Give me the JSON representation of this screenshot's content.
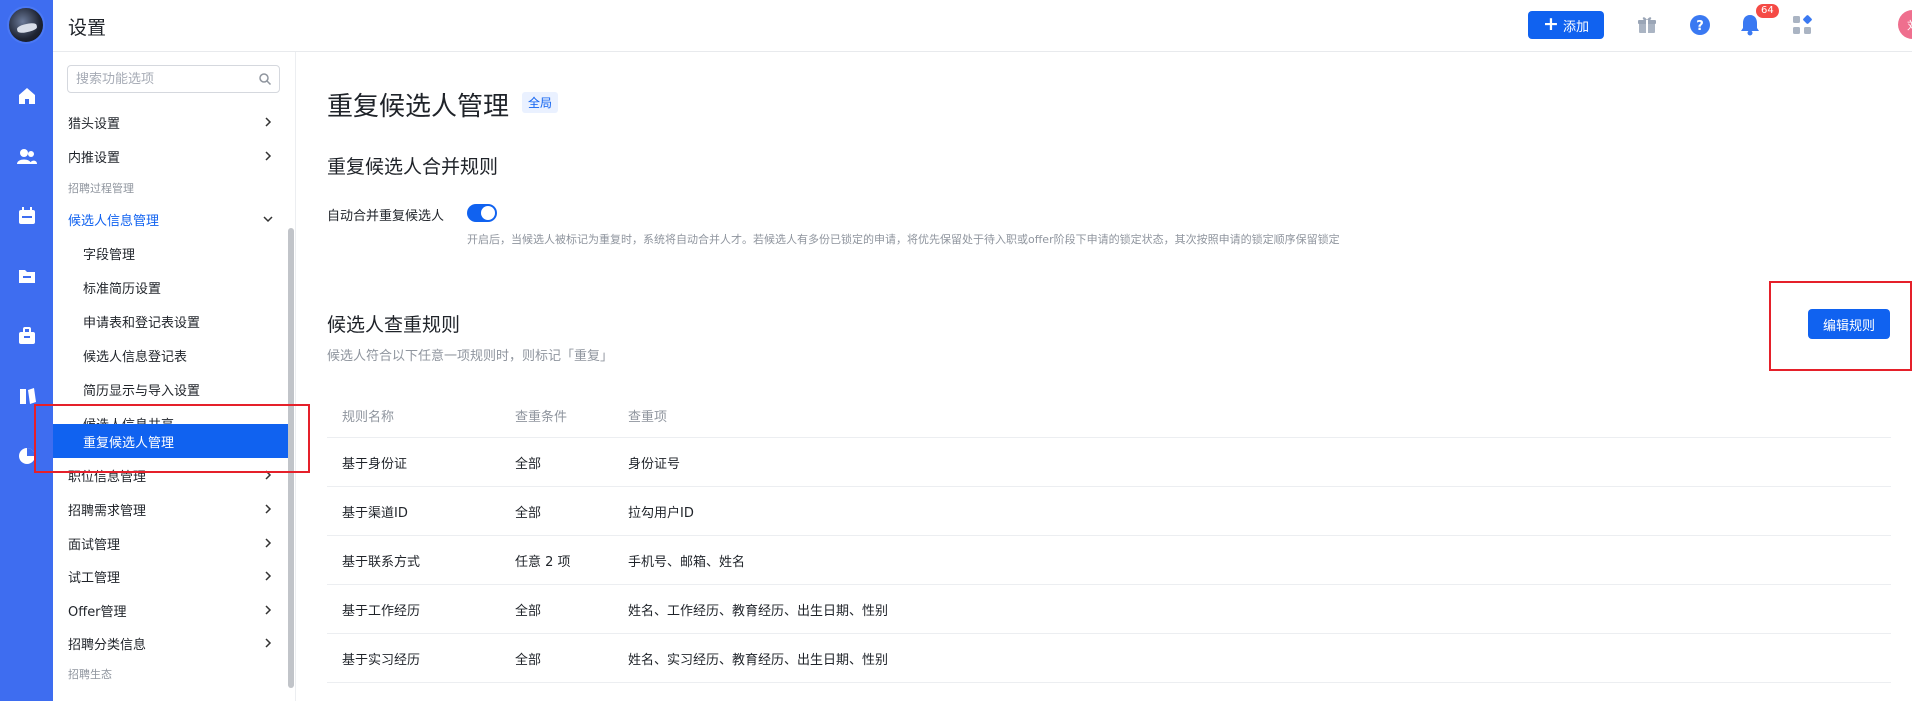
{
  "header": {
    "title": "设置",
    "add_label": "添加",
    "notification_count": "64",
    "user_initial": "刘"
  },
  "sidebar": {
    "search_placeholder": "搜索功能选项",
    "items": [
      {
        "label": "猎头设置",
        "kind": "item",
        "chevron": "right"
      },
      {
        "label": "内推设置",
        "kind": "item",
        "chevron": "right"
      },
      {
        "label": "招聘过程管理",
        "kind": "group"
      },
      {
        "label": "候选人信息管理",
        "kind": "parent-open",
        "chevron": "down"
      },
      {
        "label": "字段管理",
        "kind": "sub"
      },
      {
        "label": "标准简历设置",
        "kind": "sub"
      },
      {
        "label": "申请表和登记表设置",
        "kind": "sub"
      },
      {
        "label": "候选人信息登记表",
        "kind": "sub"
      },
      {
        "label": "简历显示与导入设置",
        "kind": "sub"
      },
      {
        "label": "候选人信息共享",
        "kind": "sub"
      },
      {
        "label": "重复候选人管理",
        "kind": "sub-selected"
      },
      {
        "label": "职位信息管理",
        "kind": "item",
        "chevron": "right"
      },
      {
        "label": "招聘需求管理",
        "kind": "item",
        "chevron": "right"
      },
      {
        "label": "面试管理",
        "kind": "item",
        "chevron": "right"
      },
      {
        "label": "试工管理",
        "kind": "item",
        "chevron": "right"
      },
      {
        "label": "Offer管理",
        "kind": "item",
        "chevron": "right"
      },
      {
        "label": "招聘分类信息",
        "kind": "item",
        "chevron": "right"
      },
      {
        "label": "招聘生态",
        "kind": "group"
      }
    ]
  },
  "main": {
    "title": "重复候选人管理",
    "scope_tag": "全局",
    "merge_section": {
      "title": "重复候选人合并规则",
      "toggle_label": "自动合并重复候选人",
      "toggle_on": true,
      "hint": "开启后，当候选人被标记为重复时，系统将自动合并人才。若候选人有多份已锁定的申请，将优先保留处于待入职或offer阶段下申请的锁定状态，其次按照申请的锁定顺序保留锁定"
    },
    "dedup_section": {
      "title": "候选人查重规则",
      "subtitle": "候选人符合以下任意一项规则时，则标记「重复」",
      "edit_button": "编辑规则",
      "columns": [
        "规则名称",
        "查重条件",
        "查重项"
      ],
      "rows": [
        {
          "name": "基于身份证",
          "condition": "全部",
          "items": "身份证号"
        },
        {
          "name": "基于渠道ID",
          "condition": "全部",
          "items": "拉勾用户ID"
        },
        {
          "name": "基于联系方式",
          "condition": "任意 2 项",
          "items": "手机号、邮箱、姓名"
        },
        {
          "name": "基于工作经历",
          "condition": "全部",
          "items": "姓名、工作经历、教育经历、出生日期、性别"
        },
        {
          "name": "基于实习经历",
          "condition": "全部",
          "items": "姓名、实习经历、教育经历、出生日期、性别"
        }
      ]
    }
  },
  "colors": {
    "rail": "#3e6df0",
    "primary": "#1062f0",
    "highlight_box": "#e5202a"
  }
}
